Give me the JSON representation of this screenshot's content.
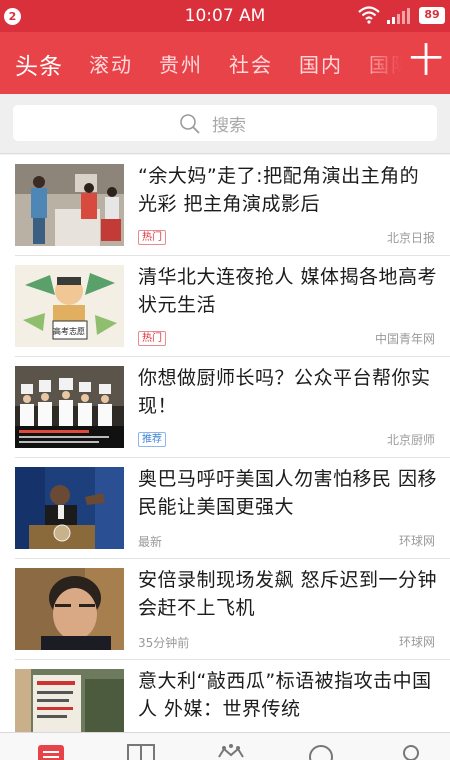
{
  "status_bar": {
    "notification_count": "2",
    "time": "10:07 AM",
    "battery": "89"
  },
  "tabs": [
    {
      "label": "头条",
      "active": true
    },
    {
      "label": "滚动",
      "active": false
    },
    {
      "label": "贵州",
      "active": false
    },
    {
      "label": "社会",
      "active": false
    },
    {
      "label": "国内",
      "active": false
    },
    {
      "label": "国际",
      "active": false
    }
  ],
  "add_tab_label": "十",
  "search": {
    "placeholder": "搜索"
  },
  "news": [
    {
      "title": "“余大妈”走了:把配角演出主角的光彩 把主角演成影后",
      "tag": "热门",
      "tag_type": "hot",
      "source": "北京日报",
      "thumb_icon": "people-photo"
    },
    {
      "title": "清华北大连夜抢人 媒体揭各地高考状元生活",
      "tag": "热门",
      "tag_type": "hot",
      "source": "中国青年网",
      "thumb_icon": "cartoon-gaokao",
      "thumb_caption": "高考志愿"
    },
    {
      "title": "你想做厨师长吗？公众平台帮你实现！",
      "tag": "推荐",
      "tag_type": "rec",
      "source": "北京厨师",
      "thumb_icon": "chefs-photo"
    },
    {
      "title": "奥巴马呼吁美国人勿害怕移民 因移民能让美国更强大",
      "time": "最新",
      "source": "环球网",
      "thumb_icon": "speaker-photo"
    },
    {
      "title": "安倍录制现场发飙 怒斥迟到一分钟会赶不上飞机",
      "time": "35分钟前",
      "source": "环球网",
      "thumb_icon": "portrait-photo"
    },
    {
      "title": "意大利“敲西瓜”标语被指攻击中国人 外媒：世界传统",
      "source": "",
      "thumb_icon": "signboard-photo"
    }
  ],
  "colors": {
    "brand_red": "#e9434a",
    "status_red": "#d9303c",
    "hot_tag": "#d9303c",
    "recommend_tag": "#3c82d6"
  },
  "bottom_nav": [
    {
      "icon": "news-icon",
      "active": true
    },
    {
      "icon": "book-icon",
      "active": false
    },
    {
      "icon": "crown-icon",
      "active": false
    },
    {
      "icon": "discover-icon",
      "active": false
    },
    {
      "icon": "user-icon",
      "active": false
    }
  ]
}
